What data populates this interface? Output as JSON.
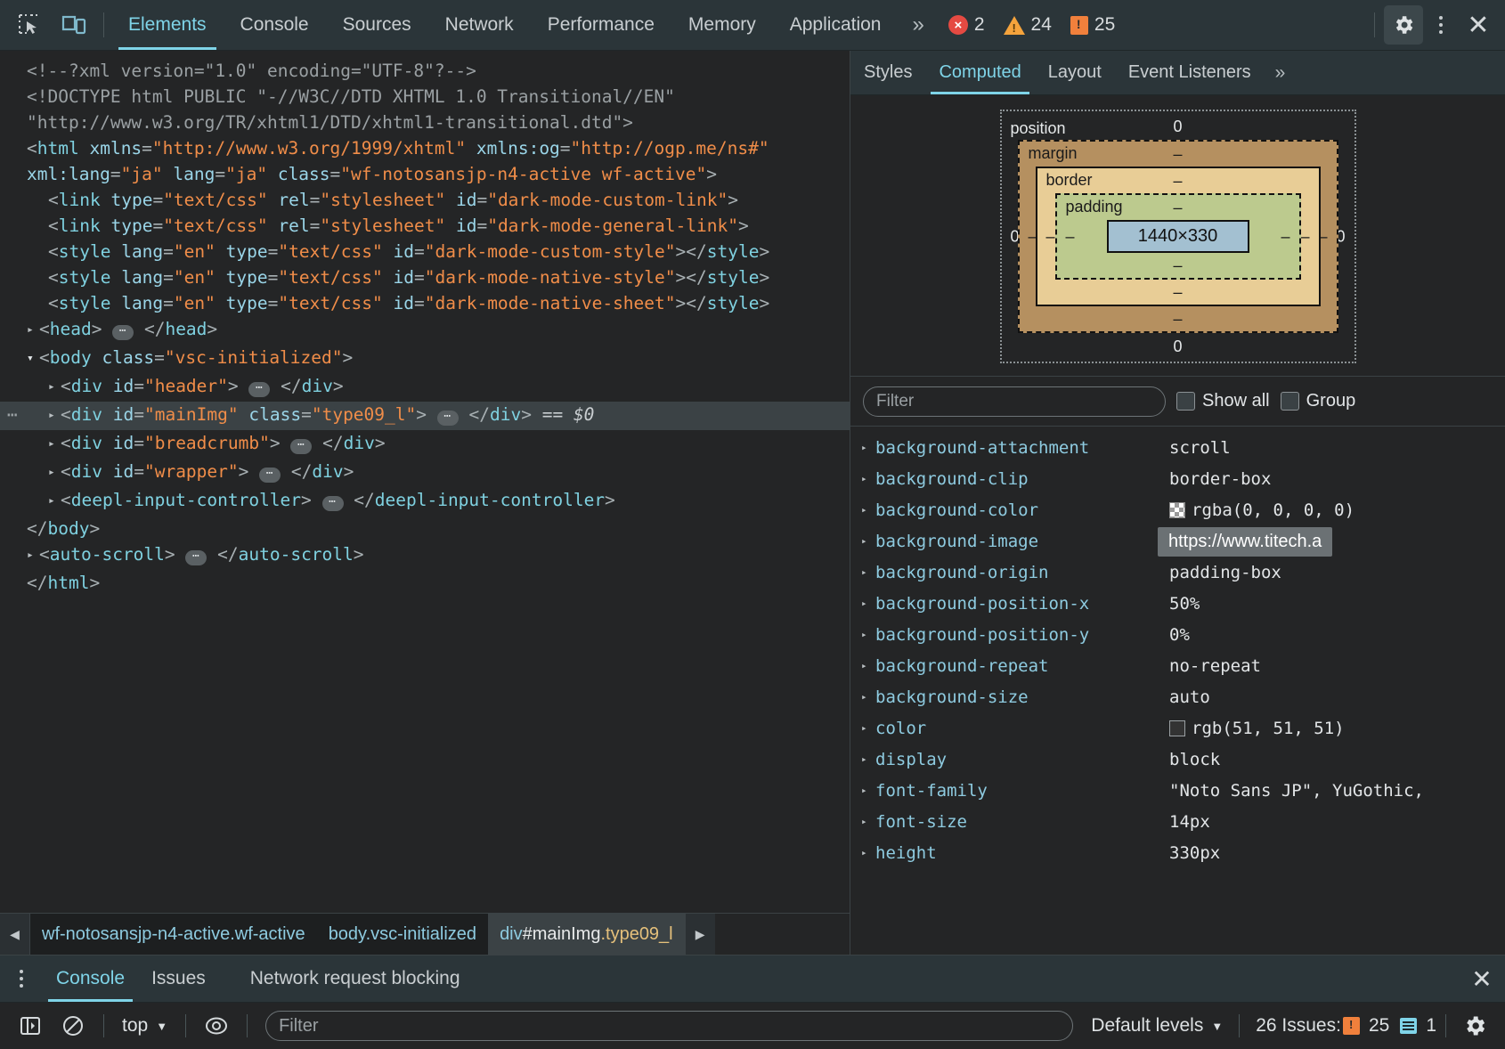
{
  "toolbar": {
    "inspect_icon": "inspect-element-icon",
    "device_icon": "device-toolbar-icon",
    "tabs": [
      {
        "label": "Elements",
        "active": true
      },
      {
        "label": "Console",
        "active": false
      },
      {
        "label": "Sources",
        "active": false
      },
      {
        "label": "Network",
        "active": false
      },
      {
        "label": "Performance",
        "active": false
      },
      {
        "label": "Memory",
        "active": false
      },
      {
        "label": "Application",
        "active": false
      }
    ],
    "more_tabs": "»",
    "counters": {
      "errors": "2",
      "warnings": "24",
      "infos": "25"
    },
    "settings_icon": "gear-icon",
    "more_icon": "more-vertical-icon",
    "close_icon": "close-icon"
  },
  "dom": {
    "lines": [
      "<!--?xml version=\"1.0\" encoding=\"UTF-8\"?-->",
      "<!DOCTYPE html PUBLIC \"-//W3C//DTD XHTML 1.0 Transitional//EN\"",
      "\"http://www.w3.org/TR/xhtml1/DTD/xhtml1-transitional.dtd\">",
      "<html xmlns=\"http://www.w3.org/1999/xhtml\" xmlns:og=\"http://ogp.me/ns#\" xml:lang=\"ja\" lang=\"ja\" class=\"wf-notosansjp-n4-active wf-active\">",
      "<link type=\"text/css\" rel=\"stylesheet\" id=\"dark-mode-custom-link\">",
      "<link type=\"text/css\" rel=\"stylesheet\" id=\"dark-mode-general-link\">",
      "<style lang=\"en\" type=\"text/css\" id=\"dark-mode-custom-style\"></style>",
      "<style lang=\"en\" type=\"text/css\" id=\"dark-mode-native-style\"></style>",
      "<style lang=\"en\" type=\"text/css\" id=\"dark-mode-native-sheet\"></style>",
      "<head>…</head>",
      "<body class=\"vsc-initialized\">",
      "<div id=\"header\">…</div>",
      "<div id=\"mainImg\" class=\"type09_l\">…</div> == $0",
      "<div id=\"breadcrumb\">…</div>",
      "<div id=\"wrapper\">…</div>",
      "<deepl-input-controller>…</deepl-input-controller>",
      "</body>",
      "<auto-scroll>…</auto-scroll>",
      "</html>"
    ],
    "selected_node": "div#mainImg.type09_l",
    "selected_marker": "== $0"
  },
  "breadcrumb": {
    "back_icon": "chevron-left-icon",
    "forward_icon": "chevron-right-icon",
    "items": [
      {
        "text": "wf-notosansjp-n4-active.wf-active",
        "selected": false
      },
      {
        "text": "body.vsc-initialized",
        "selected": false
      },
      {
        "tag": "div",
        "id": "#mainImg",
        "cls": ".type09_l",
        "selected": true
      }
    ]
  },
  "sidebar": {
    "tabs": [
      {
        "label": "Styles",
        "active": false
      },
      {
        "label": "Computed",
        "active": true
      },
      {
        "label": "Layout",
        "active": false
      },
      {
        "label": "Event Listeners",
        "active": false
      }
    ],
    "more_tabs": "»",
    "box_model": {
      "position_label": "position",
      "position_top": "0",
      "position_left": "0",
      "position_right": "0",
      "position_bottom": "0",
      "margin_label": "margin",
      "margin_top": "–",
      "margin_left": "–",
      "margin_right": "–",
      "margin_bottom": "–",
      "border_label": "border",
      "border_top": "–",
      "border_left": "–",
      "border_right": "–",
      "border_bottom": "–",
      "padding_label": "padding",
      "padding_top": "–",
      "padding_left": "–",
      "padding_right": "–",
      "padding_bottom": "–",
      "content": "1440×330"
    },
    "filter_placeholder": "Filter",
    "show_all_label": "Show all",
    "group_label": "Group",
    "url_tooltip": "https://www.titech.a",
    "properties": [
      {
        "name": "background-attachment",
        "value": "scroll",
        "swatch": "none"
      },
      {
        "name": "background-clip",
        "value": "border-box",
        "swatch": "none"
      },
      {
        "name": "background-color",
        "value": "rgba(0, 0, 0, 0)",
        "swatch": "checker"
      },
      {
        "name": "background-image",
        "value": "url(",
        "swatch": "none"
      },
      {
        "name": "background-origin",
        "value": "padding-box",
        "swatch": "none"
      },
      {
        "name": "background-position-x",
        "value": "50%",
        "swatch": "none"
      },
      {
        "name": "background-position-y",
        "value": "0%",
        "swatch": "none"
      },
      {
        "name": "background-repeat",
        "value": "no-repeat",
        "swatch": "none"
      },
      {
        "name": "background-size",
        "value": "auto",
        "swatch": "none"
      },
      {
        "name": "color",
        "value": "rgb(51, 51, 51)",
        "swatch": "dark"
      },
      {
        "name": "display",
        "value": "block",
        "swatch": "none"
      },
      {
        "name": "font-family",
        "value": "\"Noto Sans JP\", YuGothic,",
        "swatch": "none"
      },
      {
        "name": "font-size",
        "value": "14px",
        "swatch": "none"
      },
      {
        "name": "height",
        "value": "330px",
        "swatch": "none"
      }
    ]
  },
  "drawer": {
    "menu_icon": "more-vertical-icon",
    "tabs": [
      {
        "label": "Console",
        "active": true
      },
      {
        "label": "Issues",
        "active": false
      },
      {
        "label": "Network request blocking",
        "active": false
      }
    ],
    "close_icon": "close-icon",
    "console_toolbar": {
      "sidebar_icon": "show-console-sidebar-icon",
      "clear_icon": "clear-console-icon",
      "context_label": "top",
      "eye_icon": "live-expression-icon",
      "filter_placeholder": "Filter",
      "levels_label": "Default levels",
      "issues_label": "26 Issues:",
      "issues_count": "25",
      "messages_count": "1",
      "settings_icon": "gear-icon"
    }
  }
}
